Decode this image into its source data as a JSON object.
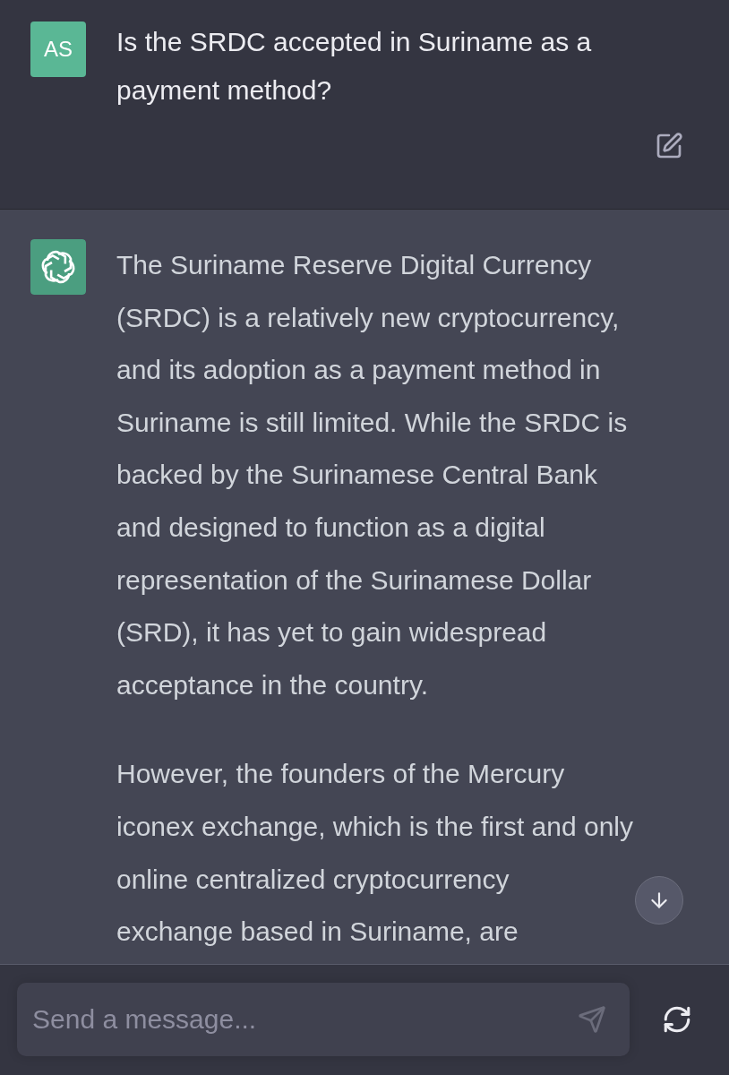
{
  "user_message": {
    "avatar_initials": "AS",
    "lines": [
      "Is the SRDC accepted in Suriname as a",
      "payment method?"
    ]
  },
  "assistant_message": {
    "paragraphs": [
      {
        "lines": [
          "The Suriname Reserve Digital Currency",
          "(SRDC) is a relatively new cryptocurrency,",
          "and its adoption as a payment method in",
          "Suriname is still limited. While the SRDC is",
          "backed by the Surinamese Central Bank",
          "and designed to function as a digital",
          "representation of the Surinamese Dollar",
          "(SRD), it has yet to gain widespread",
          "acceptance in the country."
        ]
      },
      {
        "lines": [
          "However, the founders of the Mercury",
          "iconex exchange, which is the first and only",
          "online centralized cryptocurrency",
          "exchange based in Suriname, are"
        ]
      }
    ]
  },
  "composer": {
    "placeholder": "Send a message..."
  }
}
